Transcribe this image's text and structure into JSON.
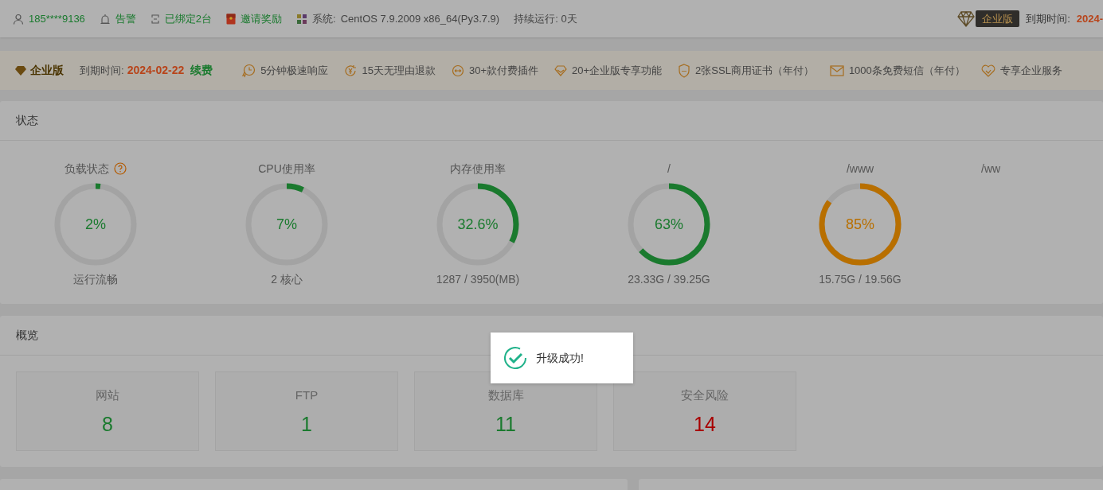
{
  "top_bar": {
    "items": [
      {
        "kind": "user",
        "text": "185****9136"
      },
      {
        "kind": "alarm",
        "text": "告警"
      },
      {
        "kind": "bind",
        "text": "已绑定2台"
      },
      {
        "kind": "gift",
        "text": "邀请奖励"
      },
      {
        "kind": "system",
        "label": "系统:",
        "text": "CentOS 7.9.2009 x86_64(Py3.7.9)"
      },
      {
        "kind": "uptime",
        "text": "持续运行: 0天"
      }
    ],
    "edition": "企业版",
    "expire_label": "到期时间:",
    "expire_date": "2024-"
  },
  "enterprise_bar": {
    "edition": "企业版",
    "expire_label": "到期时间:",
    "expire_date": "2024-02-22",
    "renew": "续费",
    "perks": [
      {
        "kind": "clock",
        "text": "5分钟极速响应"
      },
      {
        "kind": "refund",
        "text": "15天无理由退款"
      },
      {
        "kind": "plugin",
        "text": "30+款付费插件"
      },
      {
        "kind": "diamond",
        "text": "20+企业版专享功能"
      },
      {
        "kind": "shield",
        "text": "2张SSL商用证书（年付）"
      },
      {
        "kind": "mail",
        "text": "1000条免费短信（年付）"
      },
      {
        "kind": "heart",
        "text": "专享企业服务"
      }
    ]
  },
  "status": {
    "title": "状态",
    "gauges": [
      {
        "label": "负载状态",
        "help": true,
        "level": 0.02,
        "value": "2%",
        "color": "#1a7a2e",
        "caption": "运行流畅"
      },
      {
        "label": "CPU使用率",
        "level": 0.07,
        "value": "7%",
        "color": "#1a7a2e",
        "caption": "2 核心"
      },
      {
        "label": "内存使用率",
        "level": 0.326,
        "value": "32.6%",
        "color": "#1a7a2e",
        "caption": "1287 / 3950(MB)"
      },
      {
        "label": "/",
        "level": 0.63,
        "value": "63%",
        "color": "#1a7a2e",
        "caption": "23.33G / 39.25G"
      },
      {
        "label": "/www",
        "level": 0.85,
        "value": "85%",
        "color": "#b86f00",
        "caption": "15.75G / 19.56G"
      },
      {
        "label": "/ww"
      }
    ]
  },
  "overview": {
    "title": "概览",
    "cards": [
      {
        "label": "网站",
        "value": "8",
        "color": "#1a7a2e"
      },
      {
        "label": "FTP",
        "value": "1",
        "color": "#1a7a2e"
      },
      {
        "label": "数据库",
        "value": "11",
        "color": "#1a7a2e"
      },
      {
        "label": "安全风险",
        "value": "14",
        "color": "#a80000"
      }
    ]
  },
  "toast": {
    "text": "升级成功!"
  }
}
